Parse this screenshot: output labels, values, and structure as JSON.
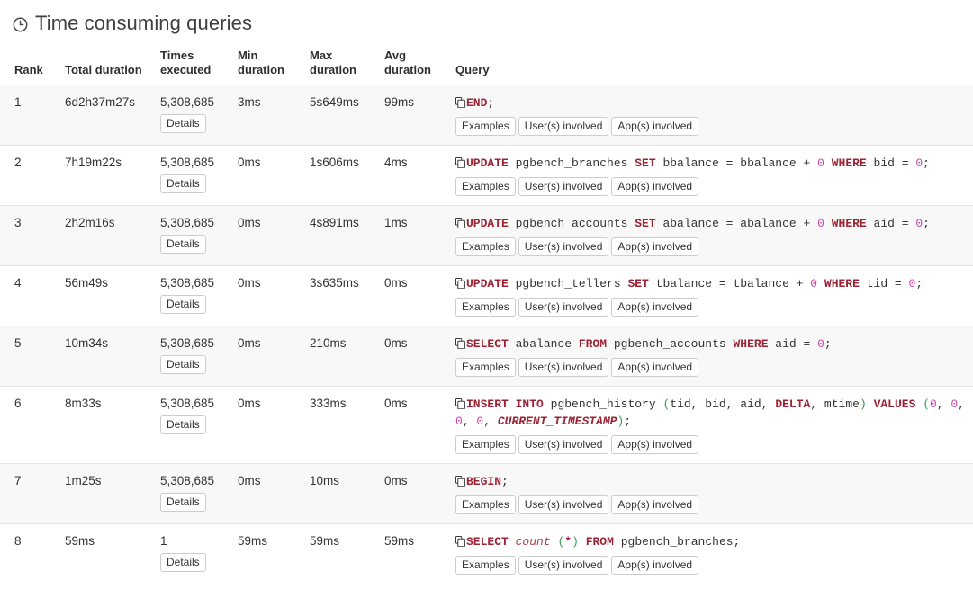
{
  "header": {
    "title": "Time consuming queries",
    "icon": "clock-icon"
  },
  "table": {
    "columns": [
      "Rank",
      "Total duration",
      "Times executed",
      "Min duration",
      "Max duration",
      "Avg duration",
      "Query"
    ],
    "buttons": {
      "details": "Details",
      "examples": "Examples",
      "users_involved": "User(s) involved",
      "apps_involved": "App(s) involved"
    },
    "copy_icon": "copy-icon",
    "rows": [
      {
        "rank": "1",
        "total_duration": "6d2h37m27s",
        "times_executed": "5,308,685",
        "min_duration": "3ms",
        "max_duration": "5s649ms",
        "avg_duration": "99ms",
        "query_text": "END;",
        "query_tokens": [
          {
            "t": "END",
            "c": "kw"
          },
          {
            "t": ";",
            "c": "op"
          }
        ]
      },
      {
        "rank": "2",
        "total_duration": "7h19m22s",
        "times_executed": "5,308,685",
        "min_duration": "0ms",
        "max_duration": "1s606ms",
        "avg_duration": "4ms",
        "query_text": "UPDATE pgbench_branches SET bbalance = bbalance + 0 WHERE bid = 0;",
        "query_tokens": [
          {
            "t": "UPDATE",
            "c": "kw"
          },
          {
            "t": " pgbench_branches ",
            "c": "op"
          },
          {
            "t": "SET",
            "c": "kw"
          },
          {
            "t": " bbalance = bbalance + ",
            "c": "op"
          },
          {
            "t": "0",
            "c": "num"
          },
          {
            "t": " ",
            "c": "op"
          },
          {
            "t": "WHERE",
            "c": "kw"
          },
          {
            "t": " bid = ",
            "c": "op"
          },
          {
            "t": "0",
            "c": "num"
          },
          {
            "t": ";",
            "c": "op"
          }
        ]
      },
      {
        "rank": "3",
        "total_duration": "2h2m16s",
        "times_executed": "5,308,685",
        "min_duration": "0ms",
        "max_duration": "4s891ms",
        "avg_duration": "1ms",
        "query_text": "UPDATE pgbench_accounts SET abalance = abalance + 0 WHERE aid = 0;",
        "query_tokens": [
          {
            "t": "UPDATE",
            "c": "kw"
          },
          {
            "t": " pgbench_accounts ",
            "c": "op"
          },
          {
            "t": "SET",
            "c": "kw"
          },
          {
            "t": " abalance = abalance + ",
            "c": "op"
          },
          {
            "t": "0",
            "c": "num"
          },
          {
            "t": " ",
            "c": "op"
          },
          {
            "t": "WHERE",
            "c": "kw"
          },
          {
            "t": " aid = ",
            "c": "op"
          },
          {
            "t": "0",
            "c": "num"
          },
          {
            "t": ";",
            "c": "op"
          }
        ]
      },
      {
        "rank": "4",
        "total_duration": "56m49s",
        "times_executed": "5,308,685",
        "min_duration": "0ms",
        "max_duration": "3s635ms",
        "avg_duration": "0ms",
        "query_text": "UPDATE pgbench_tellers SET tbalance = tbalance + 0 WHERE tid = 0;",
        "query_tokens": [
          {
            "t": "UPDATE",
            "c": "kw"
          },
          {
            "t": " pgbench_tellers ",
            "c": "op"
          },
          {
            "t": "SET",
            "c": "kw"
          },
          {
            "t": " tbalance = tbalance + ",
            "c": "op"
          },
          {
            "t": "0",
            "c": "num"
          },
          {
            "t": " ",
            "c": "op"
          },
          {
            "t": "WHERE",
            "c": "kw"
          },
          {
            "t": " tid = ",
            "c": "op"
          },
          {
            "t": "0",
            "c": "num"
          },
          {
            "t": ";",
            "c": "op"
          }
        ]
      },
      {
        "rank": "5",
        "total_duration": "10m34s",
        "times_executed": "5,308,685",
        "min_duration": "0ms",
        "max_duration": "210ms",
        "avg_duration": "0ms",
        "query_text": "SELECT abalance FROM pgbench_accounts WHERE aid = 0;",
        "query_tokens": [
          {
            "t": "SELECT",
            "c": "kw"
          },
          {
            "t": " abalance ",
            "c": "op"
          },
          {
            "t": "FROM",
            "c": "kw"
          },
          {
            "t": " pgbench_accounts ",
            "c": "op"
          },
          {
            "t": "WHERE",
            "c": "kw"
          },
          {
            "t": " aid = ",
            "c": "op"
          },
          {
            "t": "0",
            "c": "num"
          },
          {
            "t": ";",
            "c": "op"
          }
        ]
      },
      {
        "rank": "6",
        "total_duration": "8m33s",
        "times_executed": "5,308,685",
        "min_duration": "0ms",
        "max_duration": "333ms",
        "avg_duration": "0ms",
        "query_text": "INSERT INTO pgbench_history (tid, bid, aid, DELTA, mtime) VALUES (0, 0, 0, 0, CURRENT_TIMESTAMP);",
        "query_tokens": [
          {
            "t": "INSERT",
            "c": "kw"
          },
          {
            "t": " ",
            "c": "op"
          },
          {
            "t": "INTO",
            "c": "kw"
          },
          {
            "t": " pgbench_history ",
            "c": "op"
          },
          {
            "t": "(",
            "c": "par"
          },
          {
            "t": "tid, bid, aid, ",
            "c": "op"
          },
          {
            "t": "DELTA",
            "c": "kw"
          },
          {
            "t": ", mtime",
            "c": "op"
          },
          {
            "t": ")",
            "c": "par"
          },
          {
            "t": " ",
            "c": "op"
          },
          {
            "t": "VALUES",
            "c": "kw"
          },
          {
            "t": " ",
            "c": "op"
          },
          {
            "t": "(",
            "c": "par"
          },
          {
            "t": "0",
            "c": "num"
          },
          {
            "t": ", ",
            "c": "op"
          },
          {
            "t": "0",
            "c": "num"
          },
          {
            "t": ", ",
            "c": "op"
          },
          {
            "t": "0",
            "c": "num"
          },
          {
            "t": ", ",
            "c": "op"
          },
          {
            "t": "0",
            "c": "num"
          },
          {
            "t": ", ",
            "c": "op"
          },
          {
            "t": "CURRENT_TIMESTAMP",
            "c": "cst"
          },
          {
            "t": ")",
            "c": "par"
          },
          {
            "t": ";",
            "c": "op"
          }
        ]
      },
      {
        "rank": "7",
        "total_duration": "1m25s",
        "times_executed": "5,308,685",
        "min_duration": "0ms",
        "max_duration": "10ms",
        "avg_duration": "0ms",
        "query_text": "BEGIN;",
        "query_tokens": [
          {
            "t": "BEGIN",
            "c": "kw"
          },
          {
            "t": ";",
            "c": "op"
          }
        ]
      },
      {
        "rank": "8",
        "total_duration": "59ms",
        "times_executed": "1",
        "min_duration": "59ms",
        "max_duration": "59ms",
        "avg_duration": "59ms",
        "query_text": "SELECT count (*) FROM pgbench_branches;",
        "query_tokens": [
          {
            "t": "SELECT",
            "c": "kw"
          },
          {
            "t": " ",
            "c": "op"
          },
          {
            "t": "count",
            "c": "fn"
          },
          {
            "t": " ",
            "c": "op"
          },
          {
            "t": "(",
            "c": "par"
          },
          {
            "t": "*",
            "c": "kw"
          },
          {
            "t": ")",
            "c": "par"
          },
          {
            "t": " ",
            "c": "op"
          },
          {
            "t": "FROM",
            "c": "kw"
          },
          {
            "t": " pgbench_branches",
            "c": "op"
          },
          {
            "t": ";",
            "c": "op"
          }
        ]
      }
    ]
  },
  "colors": {
    "keyword": "#9C2336",
    "number": "#CC44AA",
    "paren": "#3C9A56",
    "text": "#333333",
    "row_alt_bg": "#f8f8f8",
    "border": "#e3e3e3"
  }
}
